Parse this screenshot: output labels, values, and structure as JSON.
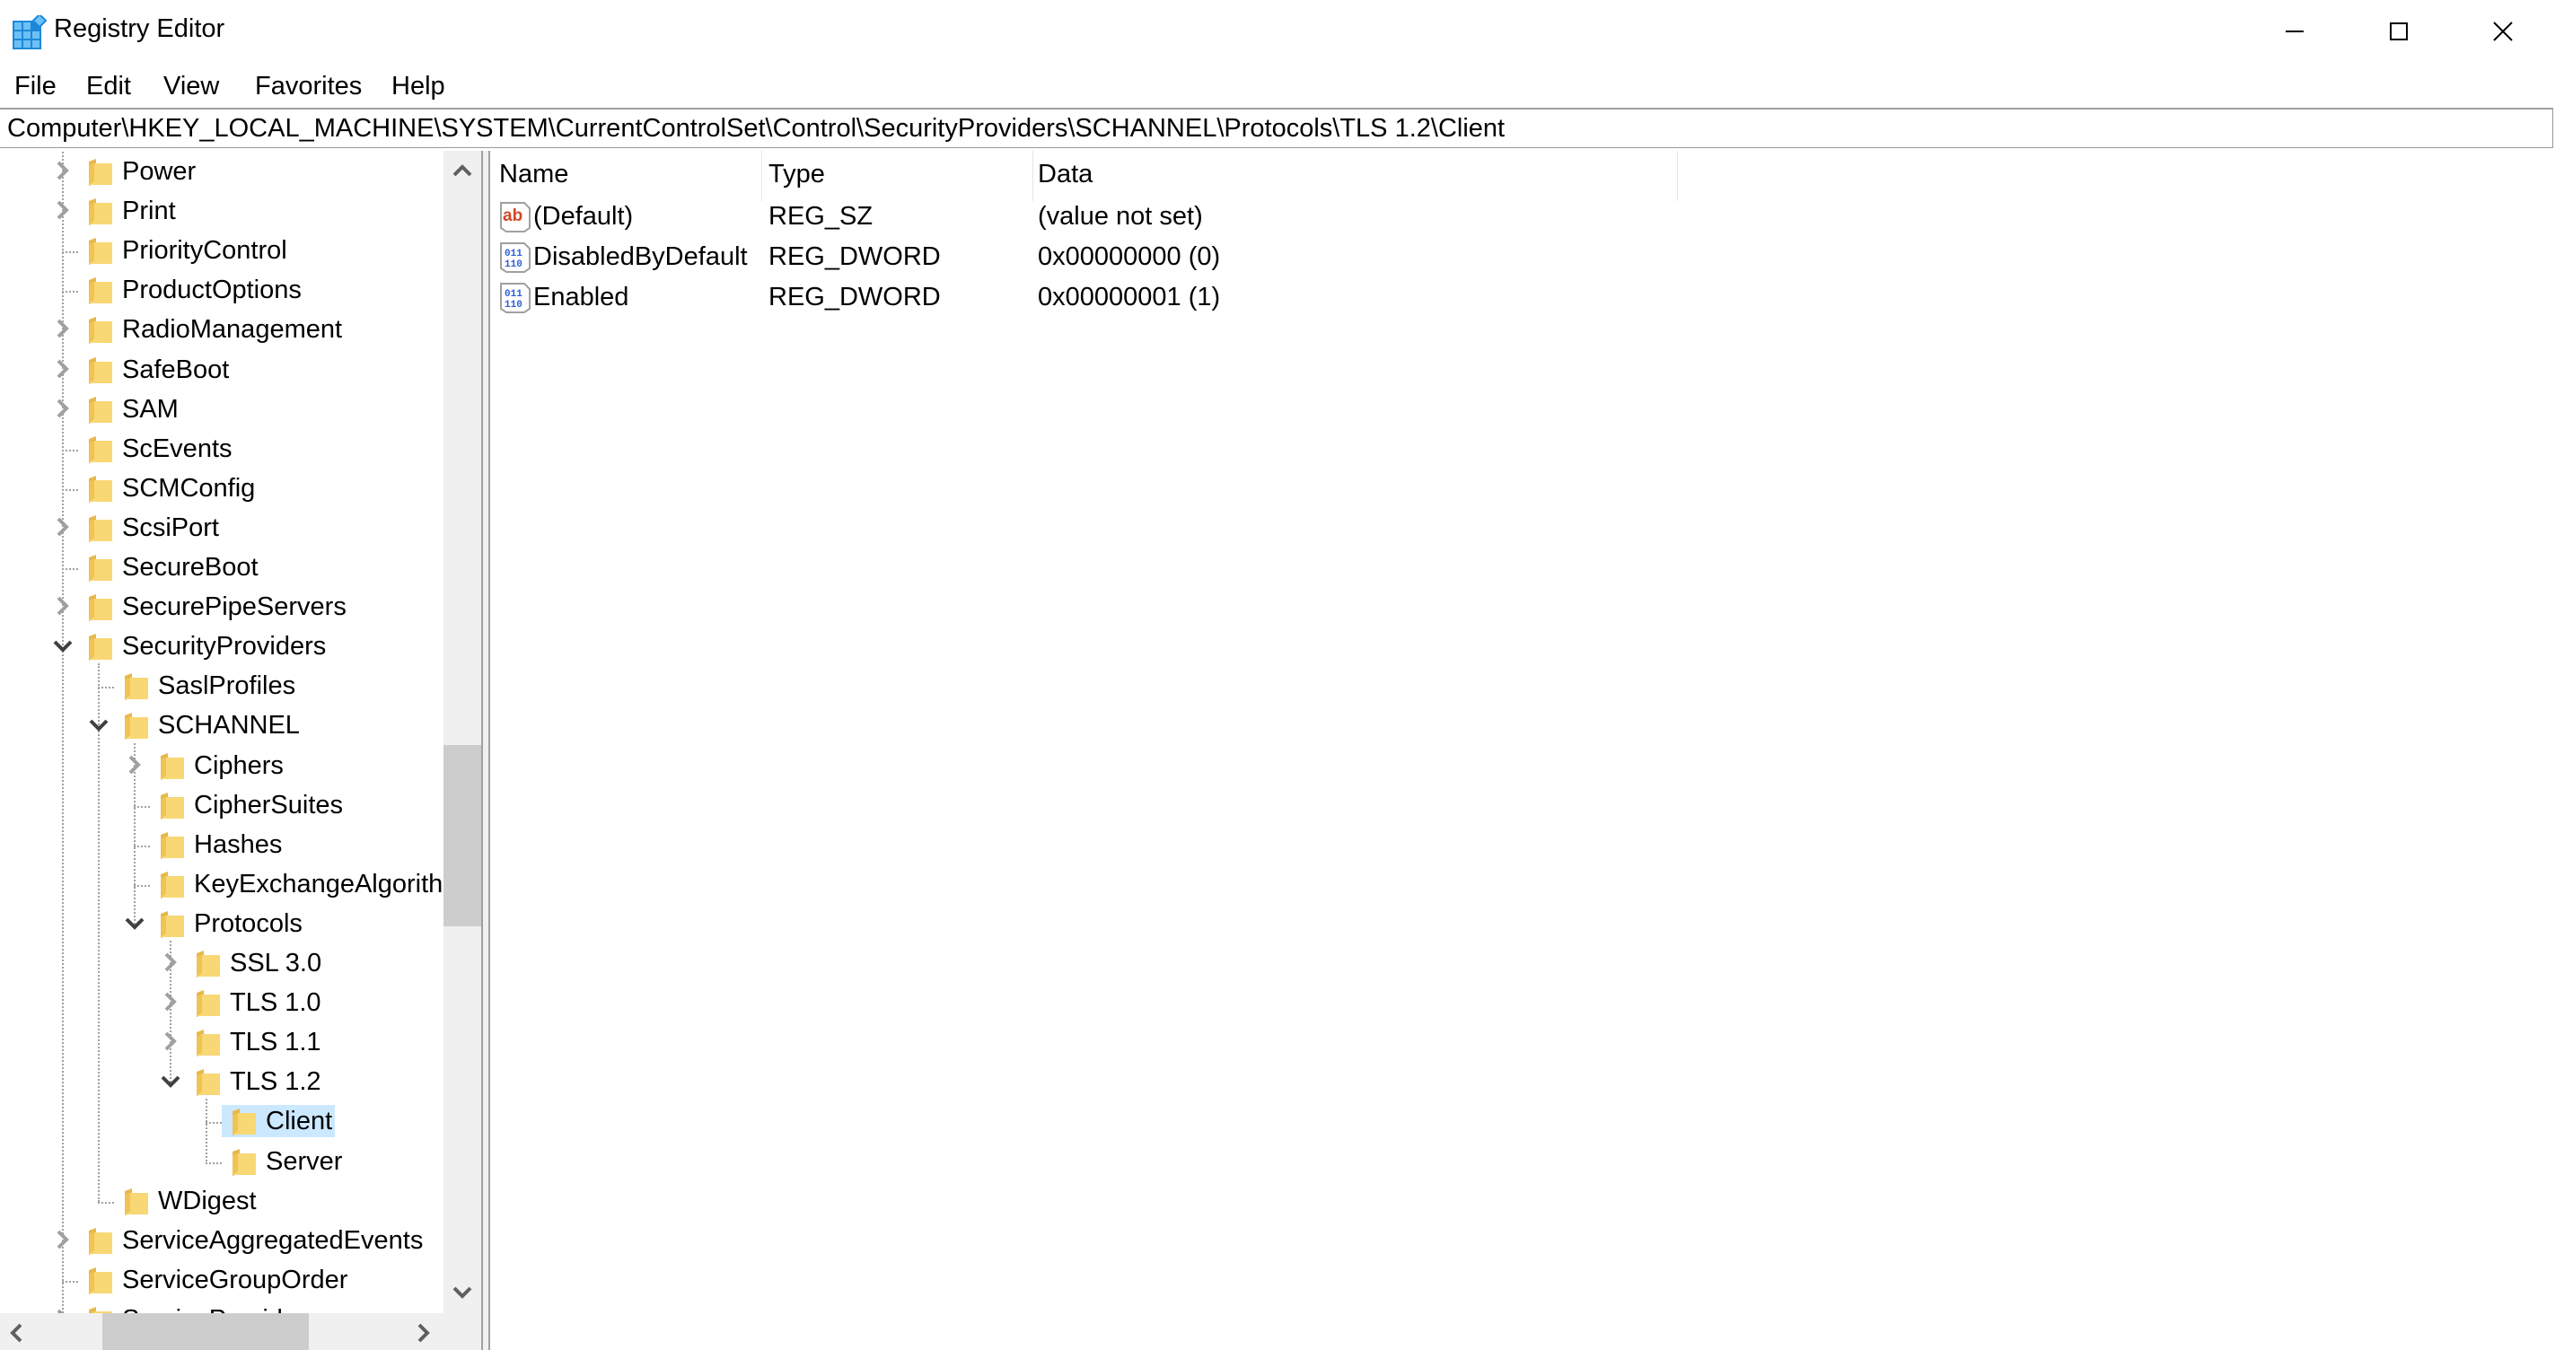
{
  "window": {
    "title": "Registry Editor",
    "controls": {
      "minimize": "minimize",
      "maximize": "maximize",
      "close": "close"
    }
  },
  "menu": [
    "File",
    "Edit",
    "View",
    "Favorites",
    "Help"
  ],
  "address": "Computer\\HKEY_LOCAL_MACHINE\\SYSTEM\\CurrentControlSet\\Control\\SecurityProviders\\SCHANNEL\\Protocols\\TLS 1.2\\Client",
  "tree": [
    {
      "label": "Power",
      "level": 0,
      "expander": "collapsed"
    },
    {
      "label": "Print",
      "level": 0,
      "expander": "collapsed"
    },
    {
      "label": "PriorityControl",
      "level": 0,
      "expander": "none"
    },
    {
      "label": "ProductOptions",
      "level": 0,
      "expander": "none"
    },
    {
      "label": "RadioManagement",
      "level": 0,
      "expander": "collapsed"
    },
    {
      "label": "SafeBoot",
      "level": 0,
      "expander": "collapsed"
    },
    {
      "label": "SAM",
      "level": 0,
      "expander": "collapsed"
    },
    {
      "label": "ScEvents",
      "level": 0,
      "expander": "none"
    },
    {
      "label": "SCMConfig",
      "level": 0,
      "expander": "none"
    },
    {
      "label": "ScsiPort",
      "level": 0,
      "expander": "collapsed"
    },
    {
      "label": "SecureBoot",
      "level": 0,
      "expander": "none"
    },
    {
      "label": "SecurePipeServers",
      "level": 0,
      "expander": "collapsed"
    },
    {
      "label": "SecurityProviders",
      "level": 0,
      "expander": "expanded"
    },
    {
      "label": "SaslProfiles",
      "level": 1,
      "expander": "none"
    },
    {
      "label": "SCHANNEL",
      "level": 1,
      "expander": "expanded"
    },
    {
      "label": "Ciphers",
      "level": 2,
      "expander": "collapsed"
    },
    {
      "label": "CipherSuites",
      "level": 2,
      "expander": "none"
    },
    {
      "label": "Hashes",
      "level": 2,
      "expander": "none"
    },
    {
      "label": "KeyExchangeAlgorith",
      "level": 2,
      "expander": "none"
    },
    {
      "label": "Protocols",
      "level": 2,
      "expander": "expanded"
    },
    {
      "label": "SSL 3.0",
      "level": 3,
      "expander": "collapsed"
    },
    {
      "label": "TLS 1.0",
      "level": 3,
      "expander": "collapsed"
    },
    {
      "label": "TLS 1.1",
      "level": 3,
      "expander": "collapsed"
    },
    {
      "label": "TLS 1.2",
      "level": 3,
      "expander": "expanded"
    },
    {
      "label": "Client",
      "level": 4,
      "expander": "none",
      "selected": true
    },
    {
      "label": "Server",
      "level": 4,
      "expander": "none"
    },
    {
      "label": "WDigest",
      "level": 1,
      "expander": "none"
    },
    {
      "label": "ServiceAggregatedEvents",
      "level": 0,
      "expander": "collapsed"
    },
    {
      "label": "ServiceGroupOrder",
      "level": 0,
      "expander": "none"
    },
    {
      "label": "ServiceProvider",
      "level": 0,
      "expander": "collapsed"
    }
  ],
  "list": {
    "columns": [
      "Name",
      "Type",
      "Data"
    ],
    "rows": [
      {
        "icon": "string-value-icon",
        "name": "(Default)",
        "type": "REG_SZ",
        "data": "(value not set)"
      },
      {
        "icon": "binary-value-icon",
        "name": "DisabledByDefault",
        "type": "REG_DWORD",
        "data": "0x00000000 (0)"
      },
      {
        "icon": "binary-value-icon",
        "name": "Enabled",
        "type": "REG_DWORD",
        "data": "0x00000001 (1)"
      }
    ]
  },
  "colors": {
    "selection": "#cce8ff",
    "folder": "#f8d775",
    "scrollbar_track": "#f0f0f0",
    "scrollbar_thumb": "#cdcdcd",
    "app_icon_blue": "#1e88d8",
    "string_icon_red": "#d24726",
    "binary_icon_blue": "#2b5fd9"
  }
}
